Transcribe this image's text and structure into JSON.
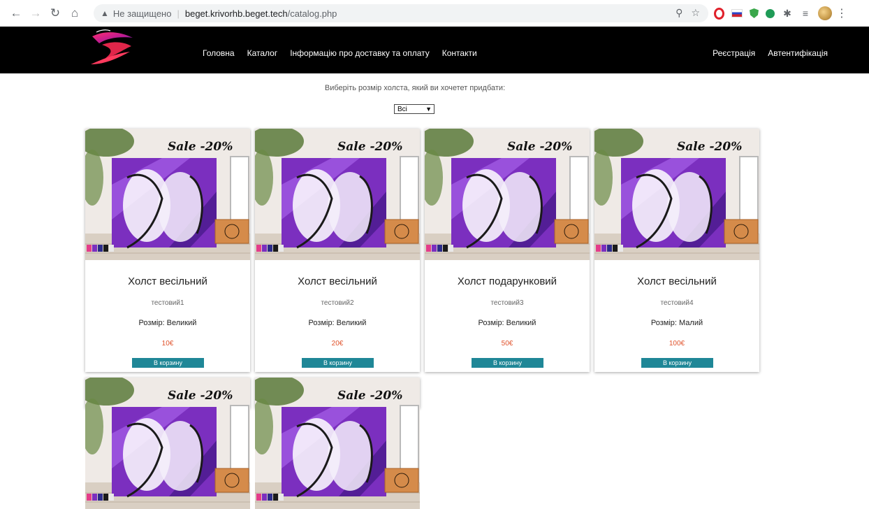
{
  "browser": {
    "insecure_label": "Не защищено",
    "url_host": "beget.krivorhb.beget.tech",
    "url_path": "/catalog.php"
  },
  "nav": {
    "items": [
      "Головна",
      "Каталог",
      "Інформацію про доставку та оплату",
      "Контакти"
    ],
    "register": "Реєстрація",
    "login": "Автентифікація"
  },
  "filter": {
    "label": "Виберіть розмір холста, який ви хочетет придбати:",
    "selected": "Всі"
  },
  "products": [
    {
      "title": "Холст весільний",
      "description": "тестовий1",
      "size": "Розмір: Великий",
      "price": "10€",
      "button": "В корзину",
      "sale": "Sale -20%"
    },
    {
      "title": "Холст весільний",
      "description": "тестовий2",
      "size": "Розмір: Великий",
      "price": "20€",
      "button": "В корзину",
      "sale": "Sale -20%"
    },
    {
      "title": "Холст подарунковий",
      "description": "тестовий3",
      "size": "Розмір: Великий",
      "price": "50€",
      "button": "В корзину",
      "sale": "Sale -20%"
    },
    {
      "title": "Холст весільний",
      "description": "тестовий4",
      "size": "Розмір: Малий",
      "price": "100€",
      "button": "В корзину",
      "sale": "Sale -20%"
    },
    {
      "sale": "Sale -20%"
    },
    {
      "sale": "Sale -20%"
    }
  ],
  "colors": {
    "header_bg": "#000000",
    "button_bg": "#1f8797",
    "price": "#e0522b",
    "canvas_purple": "#7b2fbf"
  },
  "icons": [
    "back-icon",
    "forward-icon",
    "reload-icon",
    "home-icon",
    "warning-icon",
    "zoom-icon",
    "star-icon",
    "opera-icon",
    "flag-icon",
    "shield-icon",
    "puzzle-icon",
    "media-icon",
    "avatar-icon",
    "menu-icon"
  ]
}
